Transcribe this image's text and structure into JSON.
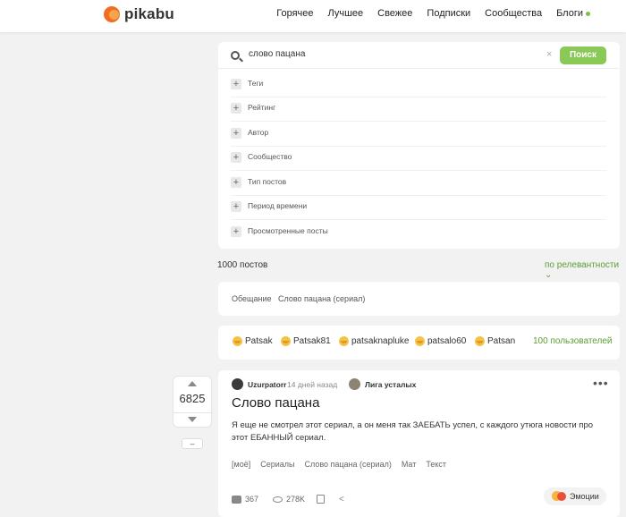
{
  "header": {
    "logo_text": "pikabu",
    "nav": [
      {
        "label": "Горячее"
      },
      {
        "label": "Лучшее"
      },
      {
        "label": "Свежее"
      },
      {
        "label": "Подписки"
      },
      {
        "label": "Сообщества"
      },
      {
        "label": "Блоги"
      }
    ]
  },
  "search": {
    "query": "слово пацана",
    "button_label": "Поиск",
    "filters": [
      "Теги",
      "Рейтинг",
      "Автор",
      "Сообщество",
      "Тип постов",
      "Период времени",
      "Просмотренные посты"
    ]
  },
  "results": {
    "count_label": "1000 постов",
    "sort_label": "по релевантности"
  },
  "related": [
    "Обещание",
    "Слово пацана (сериал)"
  ],
  "users": {
    "items": [
      "Patsak",
      "Patsak81",
      "patsaknapluke",
      "patsalo60",
      "Patsan"
    ],
    "total_label": "100 пользователей"
  },
  "post": {
    "rating": "6825",
    "minus_label": "–",
    "author": "Uzurpatorr",
    "time": "14 дней назад",
    "community": "Лига усталых",
    "more": "•••",
    "title": "Слово пацана",
    "text": "Я еще не смотрел этот сериал, а он меня так ЗАЕБАТЬ успел, с каждого утюга новости про этот ЕБАННЫЙ сериал.",
    "tags": [
      "[моё]",
      "Сериалы",
      "Слово пацана (сериал)",
      "Мат",
      "Текст"
    ],
    "comments": "367",
    "views": "278K",
    "share_glyph": "<",
    "emotions_label": "Эмоции"
  },
  "colors": {
    "accent_green": "#8ac858",
    "link_green": "#5c9e31",
    "logo_orange": "#f06d23"
  }
}
